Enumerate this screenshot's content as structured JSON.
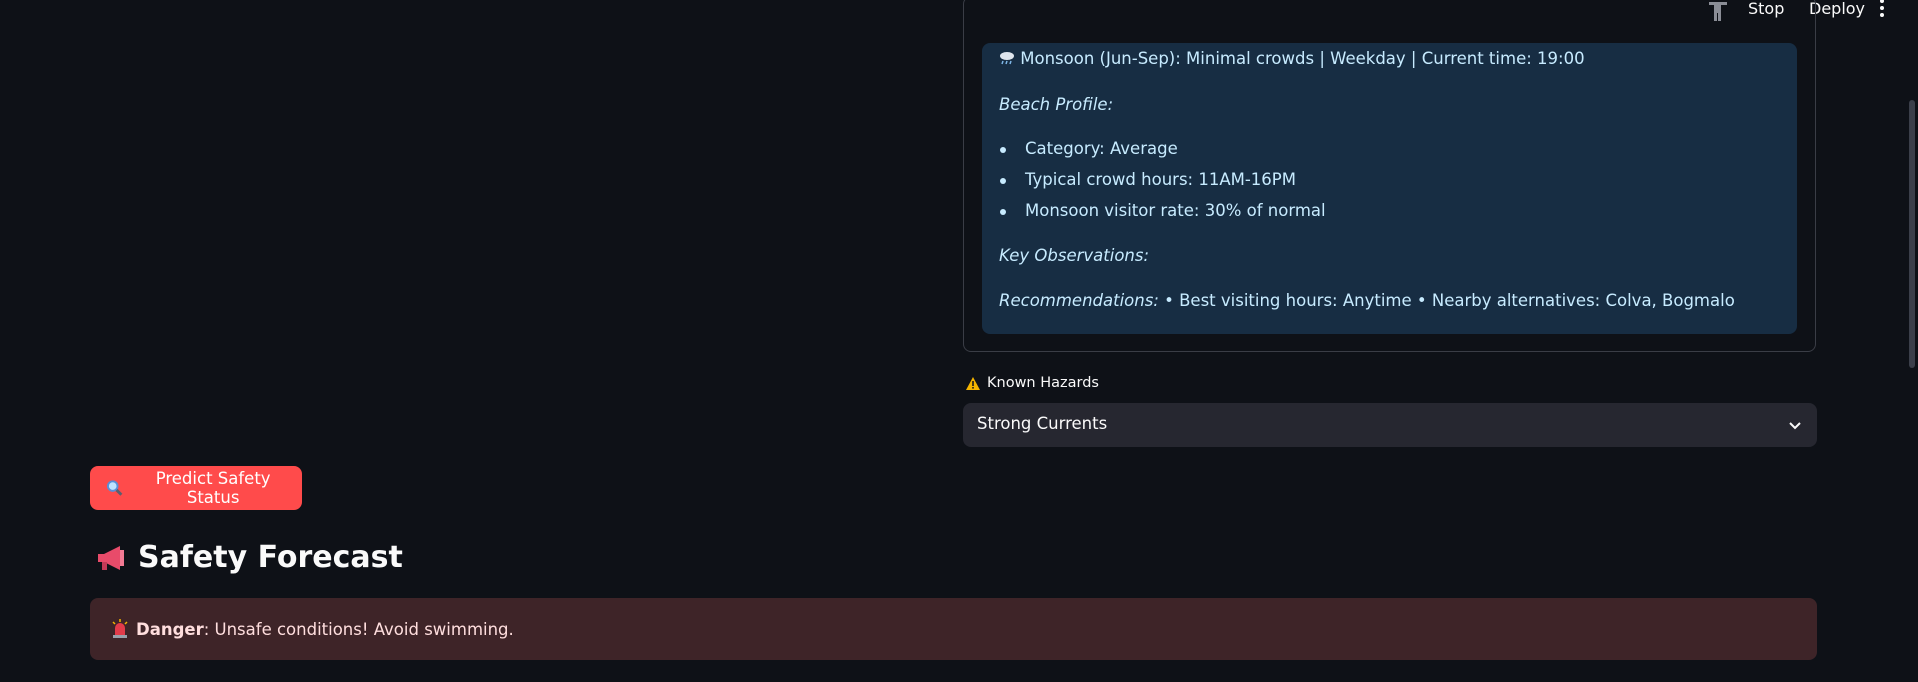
{
  "header": {
    "stop_label": "Stop",
    "deploy_label": "Deploy"
  },
  "beach_info": {
    "season_line": "Monsoon (Jun-Sep): Minimal crowds | Weekday | Current time: 19:00",
    "season_icon": "rain-cloud-icon",
    "profile_heading": "Beach Profile:",
    "profile_items": [
      "Category: Average",
      "Typical crowd hours: 11AM-16PM",
      "Monsoon visitor rate: 30% of normal"
    ],
    "observations_heading": "Key Observations:",
    "recommendations_heading": "Recommendations:",
    "recommendations_text": " • Best visiting hours: Anytime • Nearby alternatives: Colva, Bogmalo"
  },
  "hazards": {
    "label": "Known Hazards",
    "label_icon": "warning-icon",
    "selected": "Strong Currents"
  },
  "predict_button": {
    "label": "Predict Safety Status",
    "icon": "magnifier-icon"
  },
  "forecast": {
    "title": "Safety Forecast",
    "icon": "megaphone-icon",
    "alert_strong": "Danger",
    "alert_text": ": Unsafe conditions! Avoid swimming.",
    "alert_icon": "siren-icon"
  },
  "colors": {
    "background": "#0e1117",
    "info_bg": "#172d43",
    "info_text": "#c7ebff",
    "primary_button": "#ff4b4b",
    "danger_bg": "#3e2428",
    "select_bg": "#262730"
  }
}
